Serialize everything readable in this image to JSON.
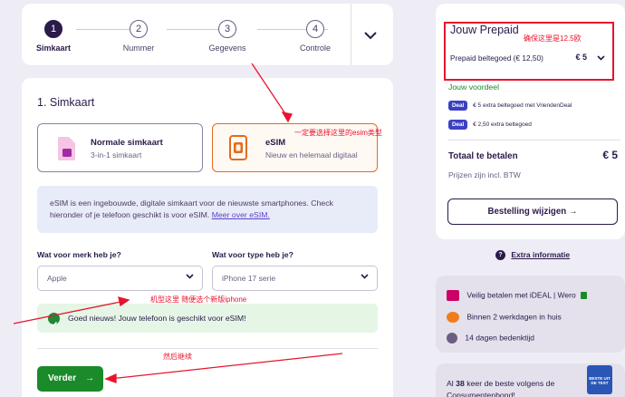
{
  "stepper": {
    "steps": [
      {
        "num": "1",
        "label": "Simkaart"
      },
      {
        "num": "2",
        "label": "Nummer"
      },
      {
        "num": "3",
        "label": "Gegevens"
      },
      {
        "num": "4",
        "label": "Controle"
      }
    ],
    "active_step": 1
  },
  "form": {
    "section_title": "1. Simkaart",
    "options": {
      "physical": {
        "title": "Normale simkaart",
        "subtitle": "3-in-1 simkaart"
      },
      "esim": {
        "title": "eSIM",
        "subtitle": "Nieuw en helemaal digitaal"
      }
    },
    "selected_option": "esim",
    "info_text": "eSIM is een ingebouwde, digitale simkaart voor de nieuwste smartphones. Check hieronder of je telefoon geschikt is voor eSIM.",
    "info_link": "Meer over eSIM.",
    "brand_label": "Wat voor merk heb je?",
    "brand_value": "Apple",
    "type_label": "Wat voor type heb je?",
    "type_value": "iPhone 17 serie",
    "success_text": "Goed nieuws! Jouw telefoon is geschikt voor eSIM!",
    "next_button": "Verder"
  },
  "summary": {
    "title": "Jouw Prepaid",
    "plan_select": "Prepaid beltegoed (€ 12,50)",
    "plan_price": "€ 5",
    "voordeel_label": "Jouw voordeel",
    "deals": [
      {
        "badge": "Deal",
        "text": "€ 5 extra beltegoed met VriendenDeal"
      },
      {
        "badge": "Deal",
        "text": "€ 2,50 extra beltegoed"
      }
    ],
    "total_label": "Totaal te betalen",
    "total_value": "€ 5",
    "vat_note": "Prijzen zijn incl. BTW",
    "edit_button": "Bestelling wijzigen",
    "extra_info": "Extra informatie"
  },
  "trust": {
    "items": [
      "Veilig betalen met iDEAL | Wero",
      "Binnen 2 werkdagen in huis",
      "14 dagen bedenktijd"
    ]
  },
  "reviews": {
    "prefix": "Al ",
    "count": "38",
    "suffix": " keer de beste volgens de Consumentenbond!",
    "badge_text": "BESTE UIT DE TEST"
  },
  "annotations": {
    "price_note": "确保这里是12.5欧",
    "esim_note": "一定要选择这里的esim类型",
    "phone_note": "机型这里 随便选个新版iphone",
    "continue_note": "然后继续"
  },
  "colors": {
    "brand_dark": "#2b1a4a",
    "selected_border": "#e36b1c",
    "success_green": "#1a8a2a",
    "annotation_red": "#e8142e",
    "deal_blue": "#3b41c4"
  }
}
